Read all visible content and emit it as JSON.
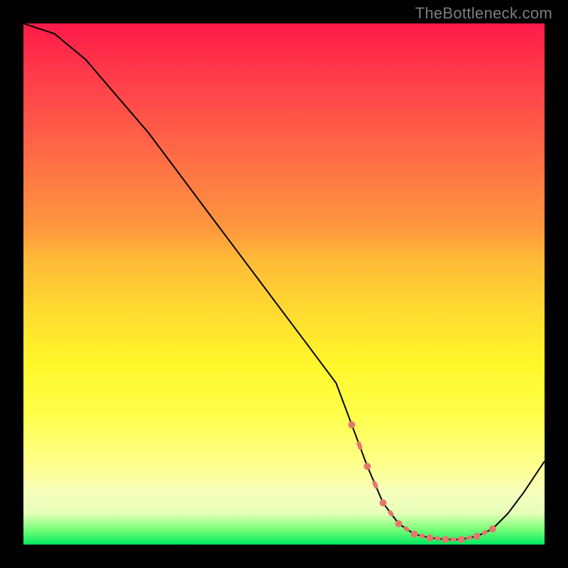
{
  "watermark": "TheBottleneck.com",
  "chart_data": {
    "type": "line",
    "title": "",
    "xlabel": "",
    "ylabel": "",
    "xlim": [
      0,
      100
    ],
    "ylim": [
      0,
      100
    ],
    "series": [
      {
        "name": "curve",
        "x": [
          0,
          6,
          12,
          18,
          24,
          30,
          36,
          42,
          48,
          54,
          60,
          63,
          66,
          69,
          72,
          75,
          78,
          81,
          84,
          87,
          90,
          93,
          96,
          100
        ],
        "y": [
          100,
          98,
          93,
          86,
          79,
          71,
          63,
          55,
          47,
          39,
          31,
          23,
          15,
          8,
          4,
          2,
          1.3,
          1,
          1,
          1.6,
          3,
          6,
          10,
          16
        ]
      }
    ],
    "highlight_segment": {
      "name": "flat-region",
      "x": [
        63,
        66,
        69,
        72,
        75,
        78,
        81,
        84,
        87,
        90
      ],
      "y": [
        23,
        15,
        8,
        4,
        2,
        1.3,
        1,
        1,
        1.6,
        3
      ]
    },
    "colors": {
      "curve": "#000000",
      "highlight": "#e5766f",
      "gradient_top": "#ff1a4a",
      "gradient_bottom": "#00e85e"
    }
  }
}
